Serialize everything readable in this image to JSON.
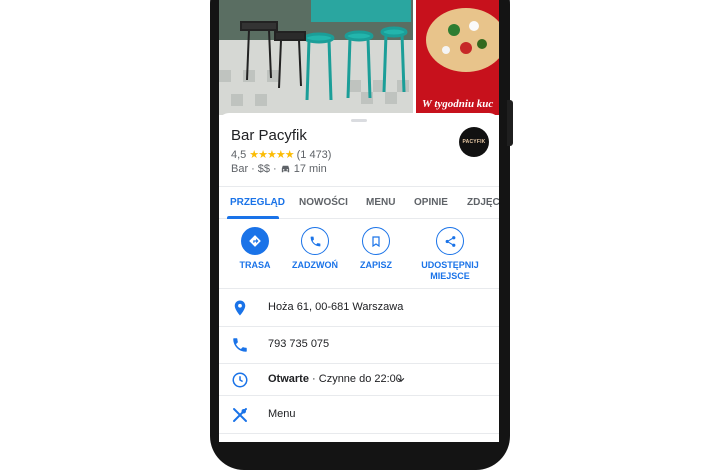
{
  "place": {
    "name": "Bar Pacyfik",
    "rating": "4,5",
    "stars": "★★★★★",
    "reviews": "(1 473)",
    "category": "Bar",
    "price": "$$",
    "sep": "·",
    "drive_time": "17 min",
    "logo_text": "PACYFIK",
    "photo_caption": "W tygodniu kuc"
  },
  "tabs": [
    {
      "label": "PRZEGLĄD"
    },
    {
      "label": "NOWOŚCI"
    },
    {
      "label": "MENU"
    },
    {
      "label": "OPINIE"
    },
    {
      "label": "ZDJĘCI"
    }
  ],
  "actions": [
    {
      "label": "TRASA",
      "icon": "directions-icon"
    },
    {
      "label": "ZADZWOŃ",
      "icon": "phone-icon"
    },
    {
      "label": "ZAPISZ",
      "icon": "bookmark-icon"
    },
    {
      "label_line1": "UDOSTĘPNIJ",
      "label_line2": "MIEJSCE",
      "icon": "share-icon"
    }
  ],
  "details": {
    "address": "Hoża 61, 00-681 Warszawa",
    "phone": "793 735 075",
    "hours_status": "Otwarte",
    "hours_detail": " · Czynne do 22:00",
    "menu": "Menu"
  },
  "colors": {
    "accent": "#1a73e8",
    "star": "#fbbc04",
    "text": "#202124",
    "secondary": "#5f6368"
  }
}
